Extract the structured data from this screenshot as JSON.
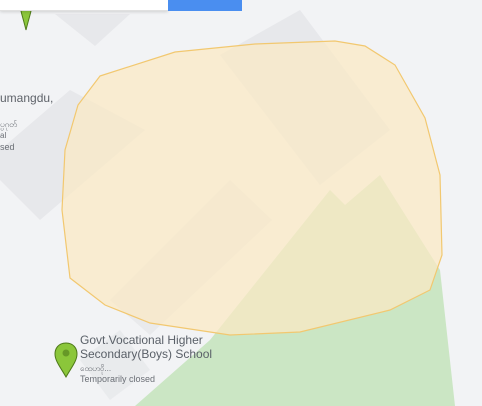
{
  "colors": {
    "background": "#f2f3f5",
    "block_fill": "#e6e7ea",
    "area_fill": "#fbe9c4",
    "area_stroke": "#f2c870",
    "park_fill": "#cbe6c4",
    "pin": "#8bc63a",
    "pin_dark": "#4f7a1a",
    "search_button": "#4a8ef0",
    "label": "#6b6f76"
  },
  "icons": {
    "pins": [
      "map-pin-icon",
      "map-pin-icon"
    ]
  },
  "place_labels": {
    "left_place_name": "umangdu,",
    "left_place_script": "ပ္ပဂုတ်",
    "left_place_sub": "al",
    "left_place_status": "sed"
  },
  "poi": {
    "name_line1": "Govt.Vocational Higher",
    "name_line2": "Secondary(Boys) School",
    "script_name": "ထေဟဝို...",
    "status": "Temporarily closed"
  }
}
